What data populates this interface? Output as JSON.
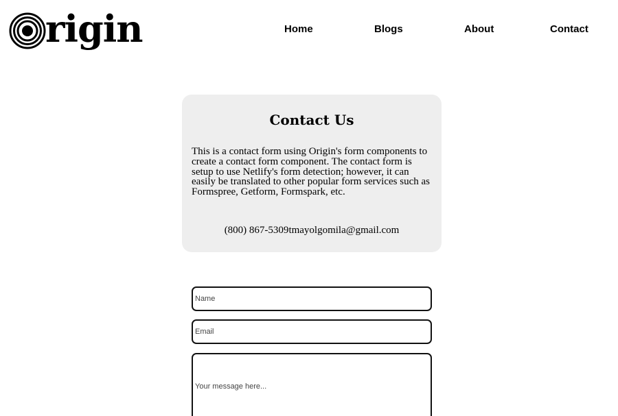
{
  "brand": {
    "name": "rigin",
    "logo_icon": "concentric-circles-O"
  },
  "nav": {
    "items": [
      "Home",
      "Blogs",
      "About",
      "Contact"
    ]
  },
  "contact_card": {
    "title": "Contact Us",
    "description": "This is a contact form using Origin's form components to create a contact form component. The contact form is setup to use Netlify's form detection; however, it can easily be translated to other popular form services such as Formspree, Getform, Formspark, etc.",
    "phone": "(800) 867-5309",
    "email": "tmayolgomila@gmail.com",
    "background_color": "#eeeeee"
  },
  "form": {
    "name_placeholder": "Name",
    "email_placeholder": "Email",
    "message_placeholder": "Your message here..."
  }
}
